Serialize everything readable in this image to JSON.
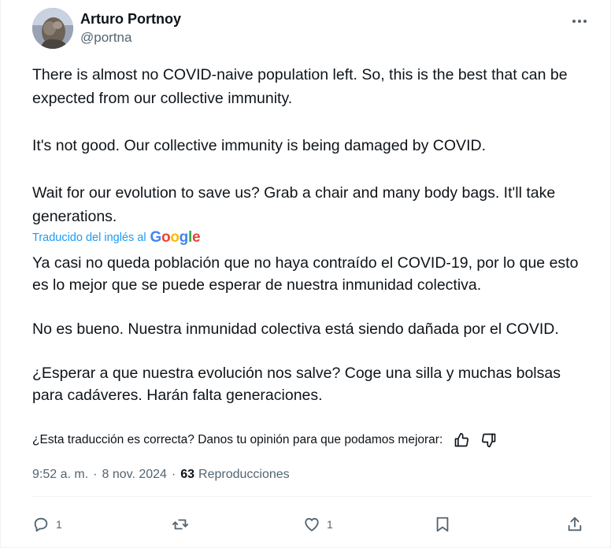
{
  "author": {
    "display_name": "Arturo Portnoy",
    "handle": "@portna"
  },
  "tweet": {
    "original_text": "There is almost no COVID-naive population left. So, this is the best that can be expected from our collective immunity.\n\nIt's not good. Our collective immunity is being damaged by COVID.\n\nWait for our evolution to save us? Grab a chair and many body bags. It'll take generations.",
    "translated_by_label": "Traducido del inglés al",
    "translator_brand": "Google",
    "translated_text": "Ya casi no queda población que no haya contraído el COVID-19, por lo que esto es lo mejor que se puede esperar de nuestra inmunidad colectiva.\n\nNo es bueno. Nuestra inmunidad colectiva está siendo dañada por el COVID.\n\n¿Esperar a que nuestra evolución nos salve? Coge una silla y muchas bolsas para cadáveres. Harán falta generaciones.",
    "feedback_prompt": "¿Esta traducción es correcta? Danos tu opinión para que podamos mejorar:"
  },
  "meta": {
    "time": "9:52 a. m.",
    "separator": "·",
    "date": "8 nov. 2024",
    "views_count": "63",
    "views_label": "Reproducciones"
  },
  "actions": {
    "reply_count": "1",
    "like_count": "1"
  },
  "colors": {
    "text": "#0f1419",
    "secondary": "#536471",
    "link": "#1d9bf0"
  },
  "icons": [
    "more-icon",
    "thumbs-up-icon",
    "thumbs-down-icon",
    "reply-icon",
    "retweet-icon",
    "like-icon",
    "bookmark-icon",
    "share-icon"
  ]
}
